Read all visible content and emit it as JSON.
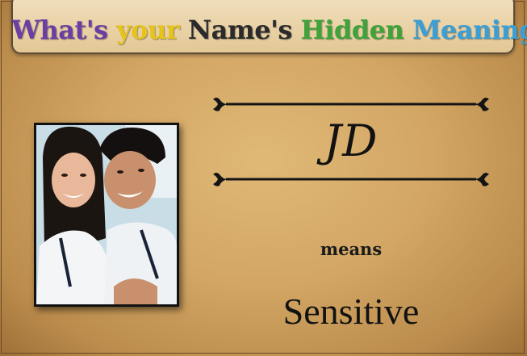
{
  "title": {
    "words": [
      {
        "text": "What's ",
        "color": "#6a3fa3"
      },
      {
        "text": "your ",
        "color": "#e6c41a"
      },
      {
        "text": "Name's ",
        "color": "#2b2b2b"
      },
      {
        "text": "Hidden ",
        "color": "#3fa33a"
      },
      {
        "text": "Meaning",
        "color": "#3a9fd6"
      },
      {
        "text": "?",
        "color": "#d93a2a"
      }
    ]
  },
  "result": {
    "name": "JD",
    "connector": "means",
    "meaning": "Sensitive"
  }
}
